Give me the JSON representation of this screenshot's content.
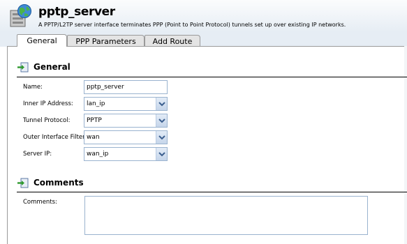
{
  "header": {
    "title": "pptp_server",
    "description": "A PPTP/L2TP server interface terminates PPP (Point to Point Protocol) tunnels set up over existing IP networks."
  },
  "tabs": [
    {
      "label": "General"
    },
    {
      "label": "PPP Parameters"
    },
    {
      "label": "Add Route"
    }
  ],
  "general": {
    "title": "General",
    "fields": {
      "name": {
        "label": "Name:",
        "value": "pptp_server"
      },
      "inner_ip": {
        "label": "Inner IP Address:",
        "value": "lan_ip"
      },
      "tunnel_protocol": {
        "label": "Tunnel Protocol:",
        "value": "PPTP"
      },
      "outer_interface": {
        "label": "Outer Interface Filter:",
        "value": "wan"
      },
      "server_ip": {
        "label": "Server IP:",
        "value": "wan_ip"
      }
    }
  },
  "comments": {
    "title": "Comments",
    "label": "Comments:",
    "value": ""
  },
  "colors": {
    "header_bg": "#e6edf4",
    "field_border": "#9ab3cf",
    "arrow": "#3c5f8f"
  }
}
